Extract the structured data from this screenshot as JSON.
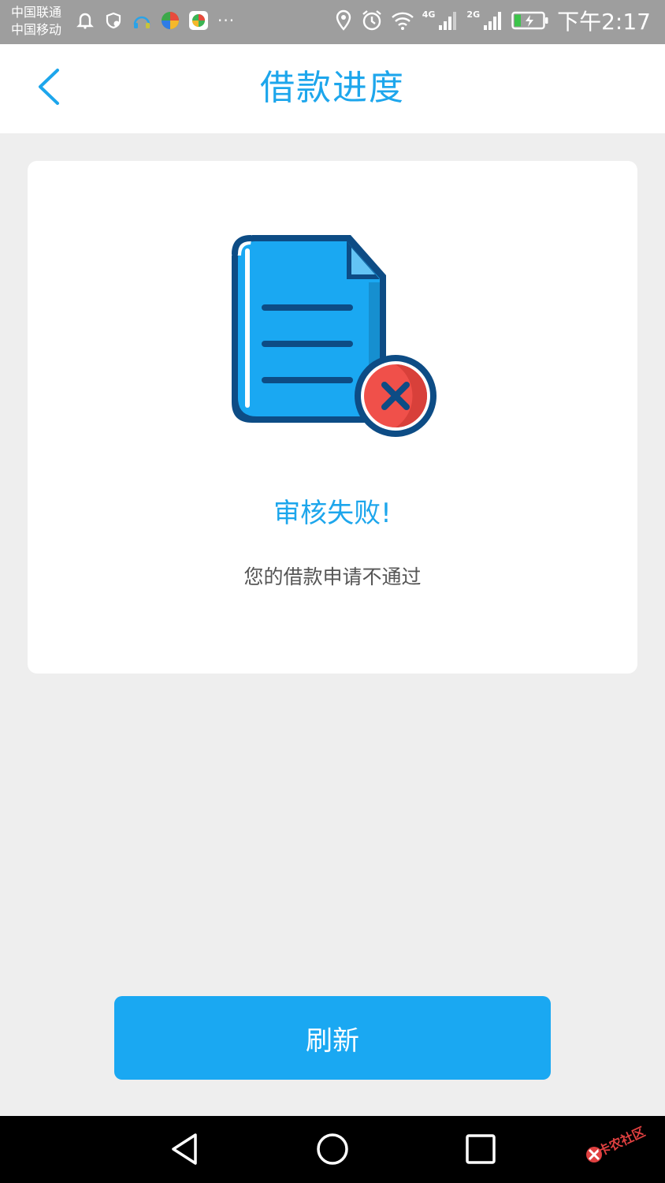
{
  "status_bar": {
    "carrier_1": "中国联通",
    "carrier_2": "中国移动",
    "more": "···",
    "net_1": "4G",
    "net_2": "2G",
    "time": "下午2:17"
  },
  "header": {
    "title": "借款进度"
  },
  "card": {
    "status_title": "审核失败!",
    "status_desc": "您的借款申请不通过"
  },
  "actions": {
    "refresh_label": "刷新"
  },
  "watermark": {
    "text": "卡农社区"
  },
  "colors": {
    "accent": "#1da6ec",
    "button": "#1aa8f2",
    "doc_fill": "#1aa8f2",
    "doc_outline": "#0d4c85",
    "error_red": "#f0504a",
    "page_bg": "#eeeeee"
  },
  "icons": [
    "back-arrow-icon",
    "document-icon",
    "error-x-icon",
    "location-icon",
    "alarm-icon",
    "wifi-icon",
    "signal-icon",
    "battery-icon",
    "nav-back-icon",
    "nav-home-icon",
    "nav-recents-icon"
  ]
}
